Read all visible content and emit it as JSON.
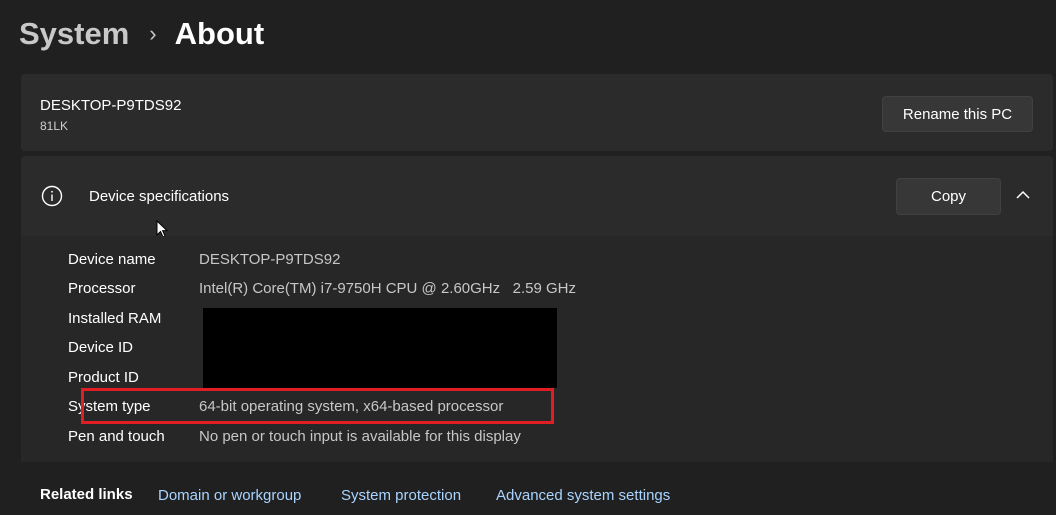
{
  "breadcrumb": {
    "parent": "System",
    "separator": "›",
    "current": "About"
  },
  "pc": {
    "name": "DESKTOP-P9TDS92",
    "model": "81LK",
    "rename_label": "Rename this PC"
  },
  "device_specs": {
    "title": "Device specifications",
    "copy_label": "Copy",
    "icon": "info-icon",
    "expand_icon": "chevron-up-icon",
    "rows": [
      {
        "label": "Device name",
        "value": "DESKTOP-P9TDS92"
      },
      {
        "label": "Processor",
        "value": "Intel(R) Core(TM) i7-9750H CPU @ 2.60GHz   2.59 GHz"
      },
      {
        "label": "Installed RAM",
        "value": ""
      },
      {
        "label": "Device ID",
        "value": ""
      },
      {
        "label": "Product ID",
        "value": ""
      },
      {
        "label": "System type",
        "value": "64-bit operating system, x64-based processor"
      },
      {
        "label": "Pen and touch",
        "value": "No pen or touch input is available for this display"
      }
    ]
  },
  "related_links": {
    "label": "Related links",
    "links": [
      "Domain or workgroup",
      "System protection",
      "Advanced system settings"
    ]
  },
  "colors": {
    "background": "#202020",
    "card": "#2b2b2b",
    "link": "#a9d4ff",
    "highlight": "#e01e23",
    "redaction": "#000000"
  }
}
